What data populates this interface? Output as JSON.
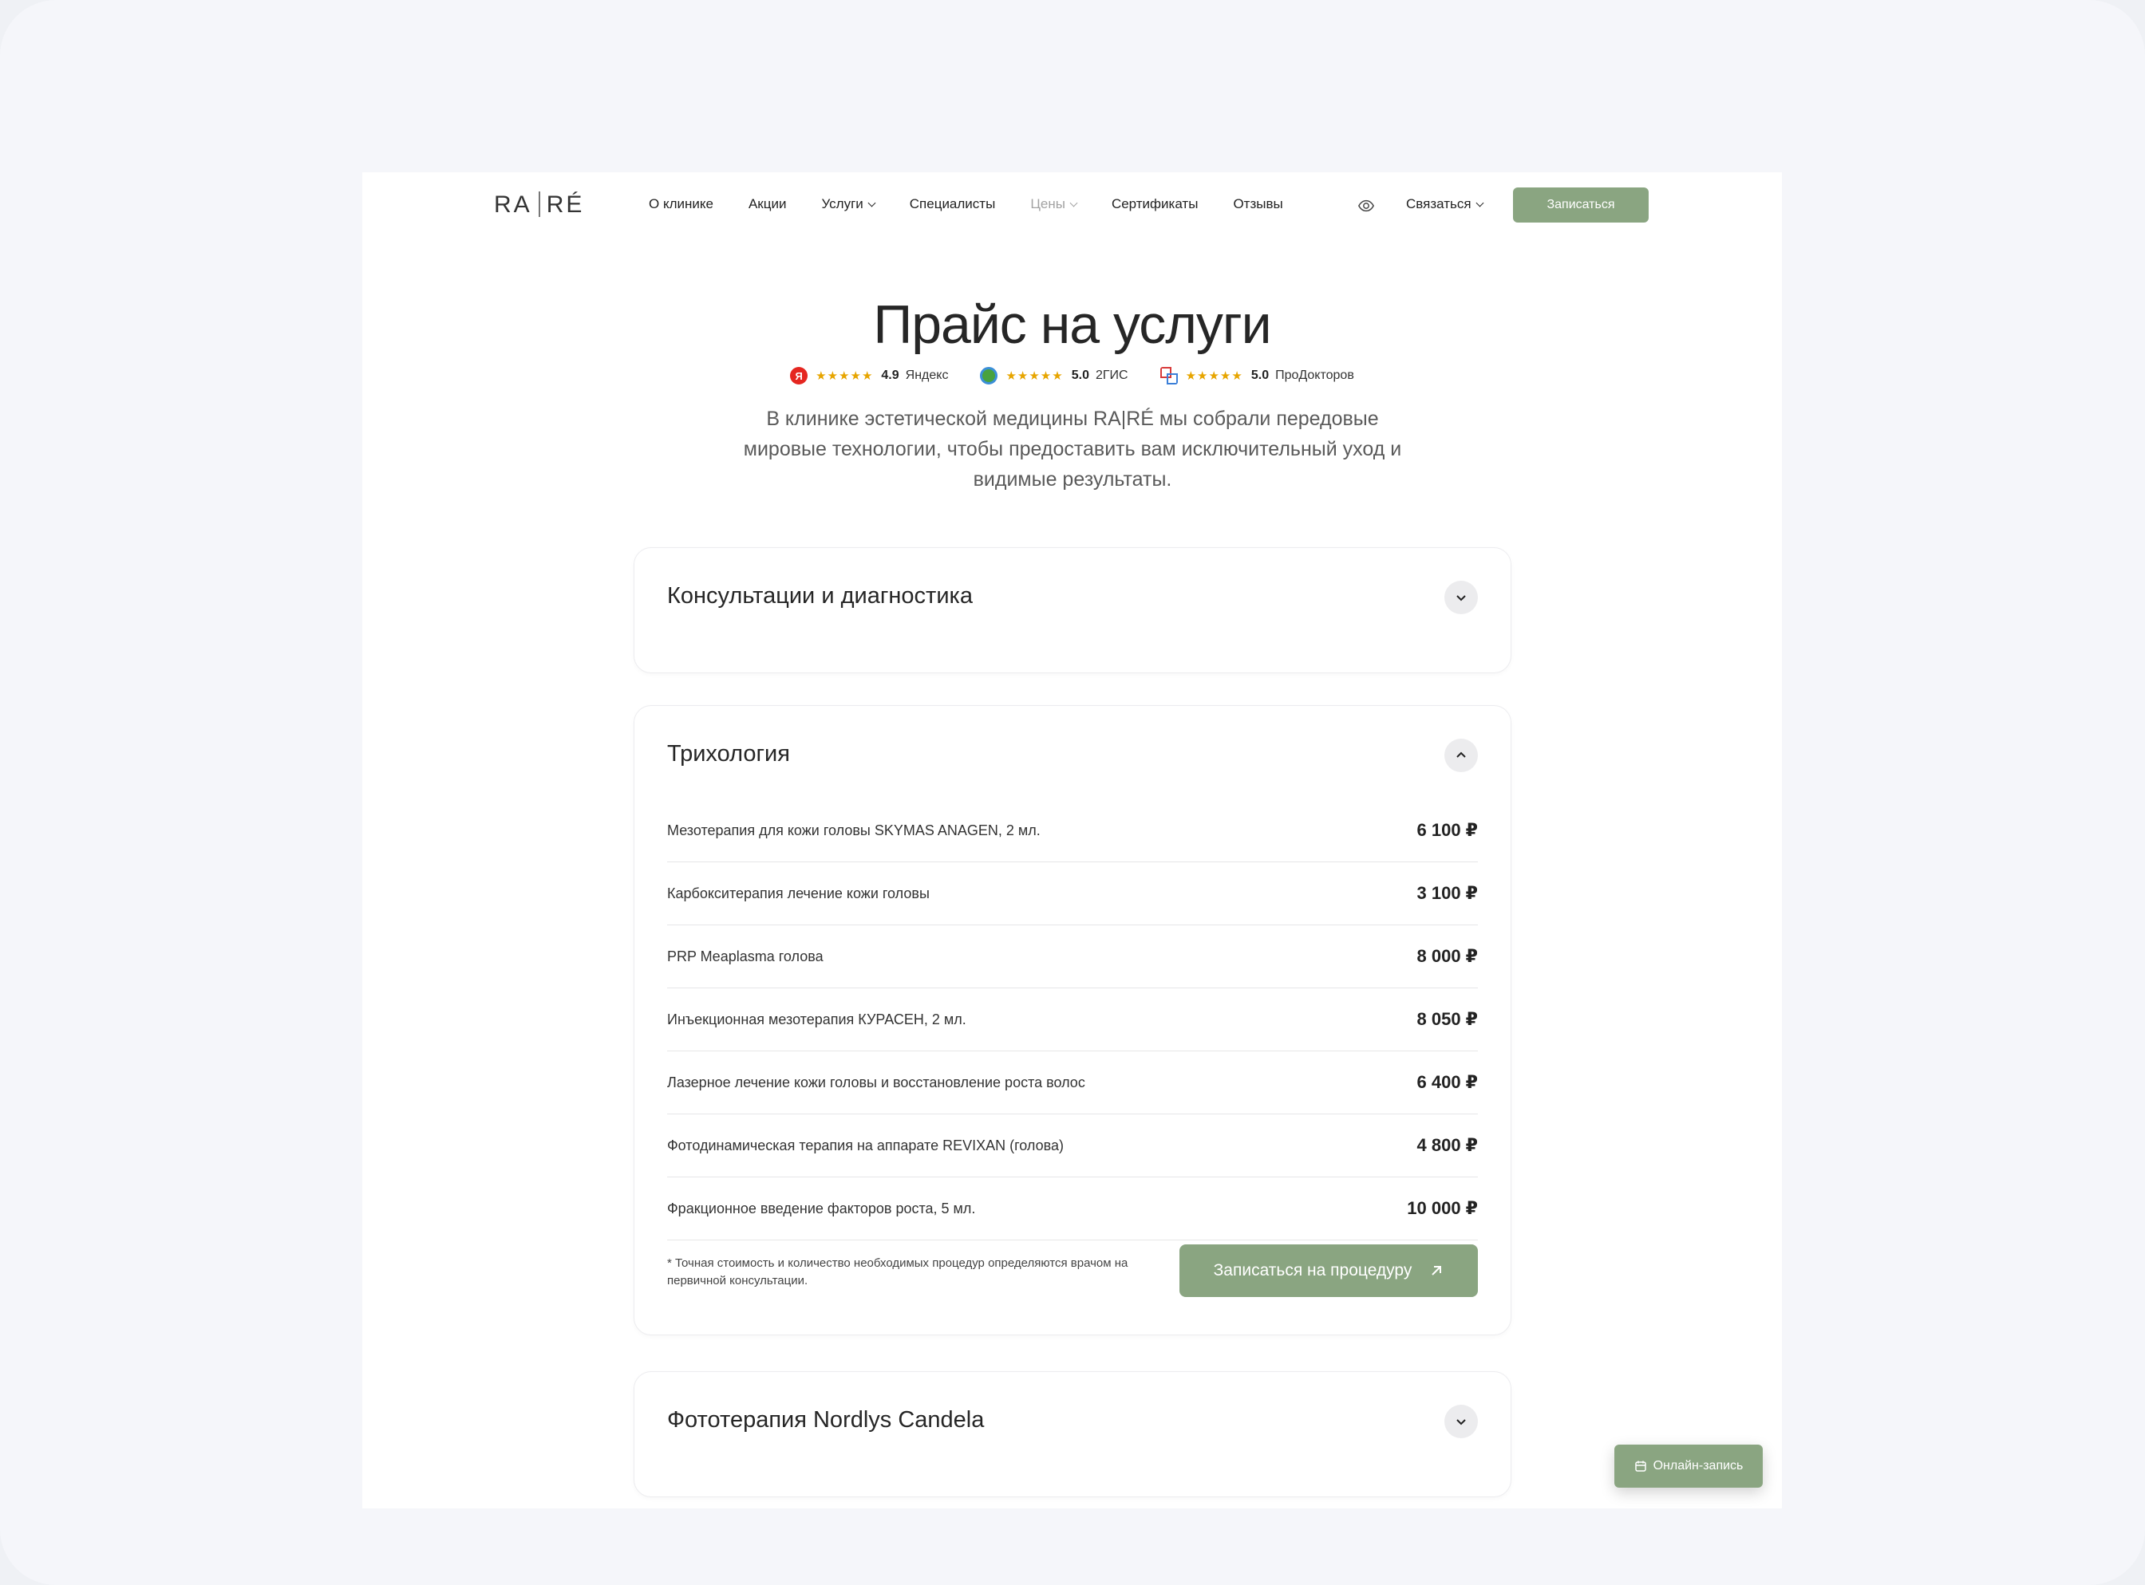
{
  "header": {
    "logo_left": "RA",
    "logo_right": "RÉ",
    "nav": [
      {
        "label": "О клинике",
        "dropdown": false
      },
      {
        "label": "Акции",
        "dropdown": false
      },
      {
        "label": "Услуги",
        "dropdown": true
      },
      {
        "label": "Специалисты",
        "dropdown": false
      },
      {
        "label": "Цены",
        "dropdown": true
      },
      {
        "label": "Сертификаты",
        "dropdown": false
      },
      {
        "label": "Отзывы",
        "dropdown": false
      }
    ],
    "contact_label": "Связаться",
    "book_label": "Записаться"
  },
  "hero": {
    "title": "Прайс на услуги",
    "ratings": [
      {
        "icon": "yandex-icon",
        "stars": "★★★★★",
        "score": "4.9",
        "name": "Яндекс"
      },
      {
        "icon": "2gis-icon",
        "stars": "★★★★★",
        "score": "5.0",
        "name": "2ГИС"
      },
      {
        "icon": "prodoctorov-icon",
        "stars": "★★★★★",
        "score": "5.0",
        "name": "ПроДокторов"
      }
    ],
    "lead": "В клинике эстетической медицины RA|RÉ мы собрали передовые мировые технологии, чтобы предоставить вам исключительный уход и видимые результаты."
  },
  "sections": [
    {
      "title": "Консультации и диагностика",
      "expanded": false
    },
    {
      "title": "Трихология",
      "expanded": true,
      "rows": [
        {
          "name": "Мезотерапия для кожи головы SKYMAS ANAGEN, 2 мл.",
          "price": "6 100 ₽"
        },
        {
          "name": "Карбокситерапия лечение кожи головы",
          "price": "3 100 ₽"
        },
        {
          "name": "PRP Meaplasma голова",
          "price": "8 000 ₽"
        },
        {
          "name": "Инъекционная мезотерапия КУРАСЕН, 2 мл.",
          "price": "8 050 ₽"
        },
        {
          "name": "Лазерное лечение кожи головы и восстановление роста волос",
          "price": "6 400 ₽"
        },
        {
          "name": "Фотодинамическая терапия на аппарате REVIXAN (голова)",
          "price": "4 800 ₽"
        },
        {
          "name": "Фракционное введение факторов роста, 5 мл.",
          "price": "10 000 ₽"
        }
      ],
      "note": "* Точная стоимость и количество необходимых процедур определяются врачом на первичной консультации.",
      "book_label": "Записаться на процедуру"
    },
    {
      "title": "Фототерапия Nordlys Candela",
      "expanded": false
    }
  ],
  "fab_label": "Онлайн-запись",
  "colors": {
    "accent": "#8aa581",
    "star": "#e7a500",
    "yandex": "#e52620"
  }
}
